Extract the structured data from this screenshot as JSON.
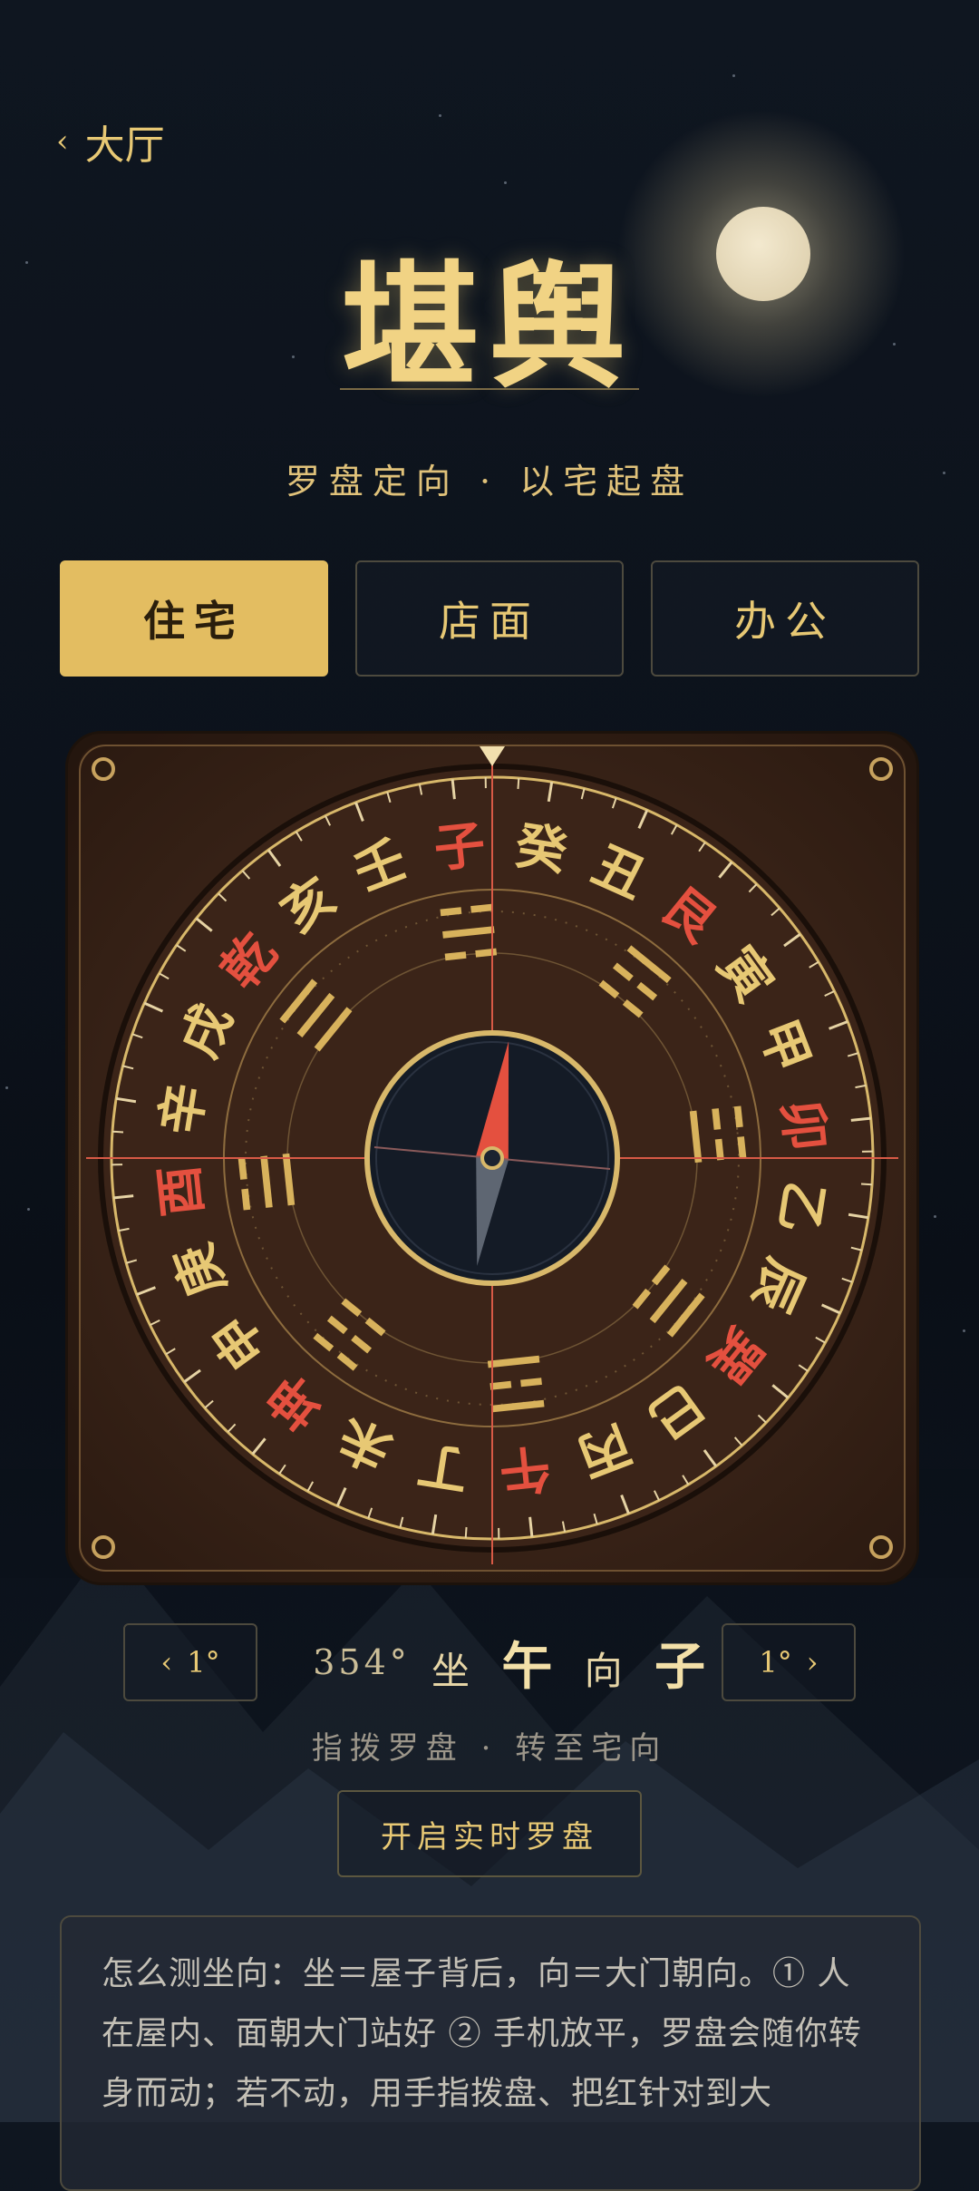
{
  "nav": {
    "back_label": "大厅"
  },
  "header": {
    "title": "堪舆",
    "subtitle": "罗盘定向 · 以宅起盘"
  },
  "tabs": [
    {
      "label": "住宅",
      "active": true
    },
    {
      "label": "店面",
      "active": false
    },
    {
      "label": "办公",
      "active": false
    }
  ],
  "compass": {
    "heading_deg": 354,
    "mountains": [
      "子",
      "癸",
      "丑",
      "艮",
      "寅",
      "甲",
      "卯",
      "乙",
      "辰",
      "巽",
      "巳",
      "丙",
      "午",
      "丁",
      "未",
      "坤",
      "申",
      "庚",
      "酉",
      "辛",
      "戌",
      "乾",
      "亥",
      "壬"
    ],
    "highlighted": [
      "子",
      "艮",
      "卯",
      "巽",
      "午",
      "坤",
      "酉",
      "乾"
    ],
    "trigrams": [
      "☵",
      "☶",
      "☳",
      "☴",
      "☲",
      "☷",
      "☱",
      "☰"
    ],
    "colors": {
      "gold": "#e7c874",
      "red": "#e4503f",
      "dark": "#1b2330"
    }
  },
  "controls": {
    "minus_label": "1°",
    "plus_label": "1°",
    "degree_text": "354°",
    "sit_label": "坐",
    "sit_value": "午",
    "face_label": "向",
    "face_value": "子"
  },
  "hint": "指拨罗盘 · 转至宅向",
  "live_button": "开启实时罗盘",
  "help_text": "怎么测坐向：坐＝屋子背后，向＝大门朝向。① 人在屋内、面朝大门站好 ② 手机放平，罗盘会随你转身而动；若不动，用手指拨盘、把红针对到大"
}
